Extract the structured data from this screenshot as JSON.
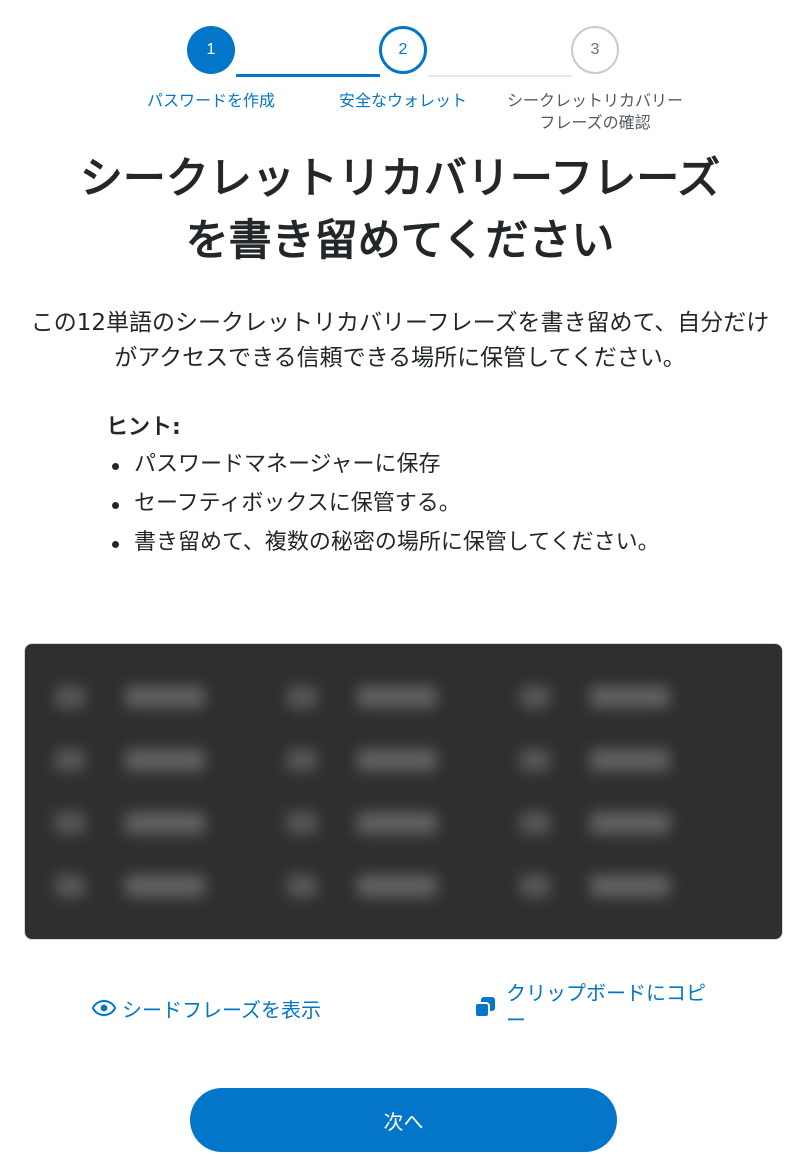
{
  "theme": {
    "accent": "#0376c9"
  },
  "stepper": {
    "steps": [
      {
        "number": "1",
        "label": "パスワードを作成",
        "state": "completed"
      },
      {
        "number": "2",
        "label": "安全なウォレット",
        "state": "current"
      },
      {
        "number": "3",
        "label": "シークレットリカバリーフレーズの確認",
        "state": "upcoming"
      }
    ]
  },
  "title": "シークレットリカバリーフレーズを書き留めてください",
  "description": "この12単語のシークレットリカバリーフレーズを書き留めて、自分だけがアクセスできる信頼できる場所に保管してください。",
  "hints": {
    "title": "ヒント:",
    "items": [
      "パスワードマネージャーに保存",
      "セーフティボックスに保管する。",
      "書き留めて、複数の秘密の場所に保管してください。"
    ]
  },
  "phrase": {
    "hidden": true,
    "word_count": 12
  },
  "actions": {
    "reveal_label": "シードフレーズを表示",
    "copy_label": "クリップボードにコピー"
  },
  "next_button": {
    "label": "次へ"
  }
}
